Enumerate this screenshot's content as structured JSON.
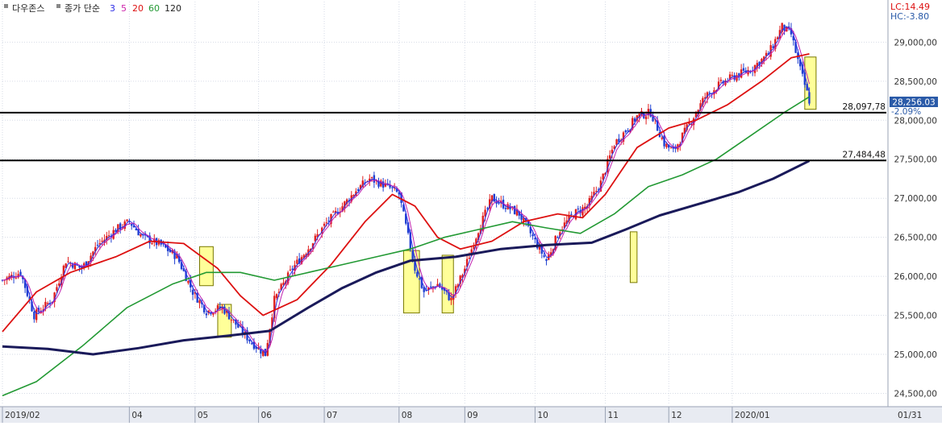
{
  "legend": {
    "title": "다우존스",
    "ma_label": "종가 단순",
    "periods": [
      {
        "label": "3",
        "color": "#2e2ee6"
      },
      {
        "label": "5",
        "color": "#cc22aa"
      },
      {
        "label": "20",
        "color": "#dd1111"
      },
      {
        "label": "60",
        "color": "#229933"
      },
      {
        "label": "120",
        "color": "#222222"
      }
    ]
  },
  "corner": {
    "lc": "LC:14.49",
    "hc": "HC:-3.80"
  },
  "price_tag": {
    "value": "28,256.03",
    "pct": "-2.09%"
  },
  "colors": {
    "up": "#e02020",
    "down": "#2040d0",
    "ma3": "#2e2ee6",
    "ma5": "#c020b0",
    "ma20": "#dd1111",
    "ma60": "#229933",
    "ma120": "#1a1a5a",
    "grid": "#d6dbe6",
    "box_fill": "#ffff99",
    "box_stroke": "#777700"
  },
  "chart_data": {
    "type": "candlestick",
    "title": "다우존스",
    "ylim": [
      24350,
      29520
    ],
    "y_ticks": [
      "29,000,00",
      "28,500,00",
      "28,000,00",
      "27,500,00",
      "27,000,00",
      "26,500,00",
      "26,000,00",
      "25,500,00",
      "25,000,00",
      "24,500,00"
    ],
    "y_tick_values": [
      29000,
      28500,
      28000,
      27500,
      27000,
      26500,
      26000,
      25500,
      25000,
      24500
    ],
    "x_labels": [
      "2019/02",
      "04",
      "05",
      "06",
      "07",
      "08",
      "09",
      "10",
      "11",
      "12",
      "2020/01",
      "01/31"
    ],
    "x_label_days": [
      0,
      56,
      85,
      113,
      142,
      175,
      204,
      235,
      266,
      294,
      322,
      385
    ],
    "x_max_day": 390,
    "h_lines": [
      {
        "label": "28,097,78",
        "value": 28097.78
      },
      {
        "label": "27,484,48",
        "value": 27484.48
      }
    ],
    "close_anchors": [
      [
        0,
        25950
      ],
      [
        8,
        26050
      ],
      [
        14,
        25500
      ],
      [
        22,
        25700
      ],
      [
        28,
        26200
      ],
      [
        35,
        26100
      ],
      [
        42,
        26400
      ],
      [
        50,
        26600
      ],
      [
        56,
        26700
      ],
      [
        62,
        26500
      ],
      [
        70,
        26400
      ],
      [
        77,
        26250
      ],
      [
        84,
        25800
      ],
      [
        90,
        25550
      ],
      [
        97,
        25600
      ],
      [
        104,
        25350
      ],
      [
        110,
        25150
      ],
      [
        116,
        25000
      ],
      [
        120,
        25700
      ],
      [
        128,
        26100
      ],
      [
        136,
        26400
      ],
      [
        142,
        26650
      ],
      [
        150,
        26900
      ],
      [
        156,
        27100
      ],
      [
        162,
        27250
      ],
      [
        170,
        27150
      ],
      [
        175,
        27050
      ],
      [
        182,
        26100
      ],
      [
        186,
        25800
      ],
      [
        192,
        25900
      ],
      [
        198,
        25700
      ],
      [
        204,
        26100
      ],
      [
        210,
        26600
      ],
      [
        216,
        27000
      ],
      [
        222,
        26900
      ],
      [
        228,
        26800
      ],
      [
        234,
        26500
      ],
      [
        240,
        26200
      ],
      [
        246,
        26600
      ],
      [
        252,
        26800
      ],
      [
        258,
        26900
      ],
      [
        264,
        27200
      ],
      [
        270,
        27700
      ],
      [
        276,
        27900
      ],
      [
        280,
        28050
      ],
      [
        286,
        28100
      ],
      [
        292,
        27700
      ],
      [
        296,
        27600
      ],
      [
        302,
        27900
      ],
      [
        310,
        28300
      ],
      [
        316,
        28450
      ],
      [
        322,
        28550
      ],
      [
        330,
        28650
      ],
      [
        338,
        28850
      ],
      [
        344,
        29200
      ],
      [
        348,
        29100
      ],
      [
        352,
        28650
      ],
      [
        356,
        28250
      ]
    ],
    "open_anchors": [
      [
        0,
        25950
      ],
      [
        8,
        26050
      ],
      [
        14,
        25500
      ],
      [
        22,
        25700
      ],
      [
        28,
        26200
      ],
      [
        35,
        26100
      ],
      [
        42,
        26400
      ],
      [
        50,
        26600
      ],
      [
        56,
        26700
      ],
      [
        62,
        26500
      ],
      [
        70,
        26400
      ],
      [
        77,
        26250
      ],
      [
        84,
        25800
      ],
      [
        90,
        25550
      ],
      [
        97,
        25600
      ],
      [
        104,
        25350
      ],
      [
        110,
        25150
      ],
      [
        116,
        25000
      ],
      [
        120,
        25700
      ],
      [
        128,
        26100
      ],
      [
        136,
        26400
      ],
      [
        142,
        26650
      ],
      [
        150,
        26900
      ],
      [
        156,
        27100
      ],
      [
        162,
        27250
      ],
      [
        170,
        27150
      ],
      [
        175,
        27050
      ],
      [
        182,
        26100
      ],
      [
        186,
        25800
      ],
      [
        192,
        25900
      ],
      [
        198,
        25700
      ],
      [
        204,
        26100
      ],
      [
        210,
        26600
      ],
      [
        216,
        27000
      ],
      [
        222,
        26900
      ],
      [
        228,
        26800
      ],
      [
        234,
        26500
      ],
      [
        240,
        26200
      ],
      [
        246,
        26600
      ],
      [
        252,
        26800
      ],
      [
        258,
        26900
      ],
      [
        264,
        27200
      ],
      [
        270,
        27700
      ],
      [
        276,
        27900
      ],
      [
        280,
        28050
      ],
      [
        286,
        28100
      ],
      [
        292,
        27700
      ],
      [
        296,
        27600
      ],
      [
        302,
        27900
      ],
      [
        310,
        28300
      ],
      [
        316,
        28450
      ],
      [
        322,
        28550
      ],
      [
        330,
        28650
      ],
      [
        338,
        28850
      ],
      [
        344,
        29200
      ],
      [
        348,
        29100
      ],
      [
        352,
        28650
      ],
      [
        356,
        28250
      ]
    ],
    "series": [
      {
        "name": "20",
        "values": [
          [
            0,
            25290
          ],
          [
            15,
            25800
          ],
          [
            30,
            26050
          ],
          [
            50,
            26250
          ],
          [
            65,
            26450
          ],
          [
            80,
            26420
          ],
          [
            95,
            26100
          ],
          [
            105,
            25750
          ],
          [
            115,
            25500
          ],
          [
            130,
            25700
          ],
          [
            145,
            26150
          ],
          [
            160,
            26700
          ],
          [
            172,
            27050
          ],
          [
            182,
            26900
          ],
          [
            192,
            26500
          ],
          [
            202,
            26350
          ],
          [
            216,
            26450
          ],
          [
            230,
            26700
          ],
          [
            245,
            26800
          ],
          [
            256,
            26750
          ],
          [
            266,
            27050
          ],
          [
            280,
            27650
          ],
          [
            294,
            27900
          ],
          [
            306,
            28000
          ],
          [
            320,
            28200
          ],
          [
            335,
            28500
          ],
          [
            348,
            28800
          ],
          [
            356,
            28850
          ]
        ]
      },
      {
        "name": "60",
        "values": [
          [
            0,
            24470
          ],
          [
            15,
            24650
          ],
          [
            35,
            25100
          ],
          [
            55,
            25600
          ],
          [
            75,
            25900
          ],
          [
            90,
            26050
          ],
          [
            105,
            26050
          ],
          [
            120,
            25950
          ],
          [
            135,
            26050
          ],
          [
            150,
            26150
          ],
          [
            165,
            26250
          ],
          [
            180,
            26350
          ],
          [
            195,
            26500
          ],
          [
            210,
            26600
          ],
          [
            225,
            26700
          ],
          [
            240,
            26620
          ],
          [
            255,
            26550
          ],
          [
            270,
            26800
          ],
          [
            285,
            27150
          ],
          [
            300,
            27300
          ],
          [
            315,
            27500
          ],
          [
            330,
            27800
          ],
          [
            345,
            28100
          ],
          [
            356,
            28300
          ]
        ]
      },
      {
        "name": "120",
        "values": [
          [
            0,
            25100
          ],
          [
            20,
            25070
          ],
          [
            40,
            25000
          ],
          [
            60,
            25080
          ],
          [
            80,
            25180
          ],
          [
            100,
            25240
          ],
          [
            118,
            25300
          ],
          [
            135,
            25600
          ],
          [
            150,
            25850
          ],
          [
            165,
            26050
          ],
          [
            180,
            26200
          ],
          [
            200,
            26250
          ],
          [
            220,
            26350
          ],
          [
            240,
            26400
          ],
          [
            260,
            26430
          ],
          [
            275,
            26600
          ],
          [
            290,
            26780
          ],
          [
            310,
            26950
          ],
          [
            325,
            27080
          ],
          [
            340,
            27250
          ],
          [
            356,
            27480
          ]
        ]
      }
    ],
    "highlight_boxes": [
      {
        "day0": 87,
        "day1": 93,
        "y_top": 26380,
        "y_bottom": 25880
      },
      {
        "day0": 95,
        "day1": 101,
        "y_top": 25640,
        "y_bottom": 25220
      },
      {
        "day0": 177,
        "day1": 184,
        "y_top": 26330,
        "y_bottom": 25530
      },
      {
        "day0": 194,
        "day1": 199,
        "y_top": 26270,
        "y_bottom": 25530
      },
      {
        "day0": 277,
        "day1": 280,
        "y_top": 26570,
        "y_bottom": 25920
      },
      {
        "day0": 354,
        "day1": 359,
        "y_top": 28810,
        "y_bottom": 28140
      }
    ]
  }
}
